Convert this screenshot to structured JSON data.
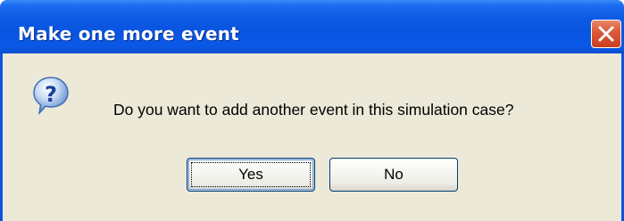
{
  "window": {
    "title": "Make one more event",
    "close_icon": "close-icon"
  },
  "dialog": {
    "icon": "question-icon",
    "message": "Do you want to add another event in this simulation case?"
  },
  "buttons": {
    "yes_label": "Yes",
    "no_label": "No"
  },
  "colors": {
    "titlebar": "#0954e0",
    "client_background": "#ece9d8",
    "close_button": "#dd5a3a",
    "button_border": "#003c74"
  }
}
